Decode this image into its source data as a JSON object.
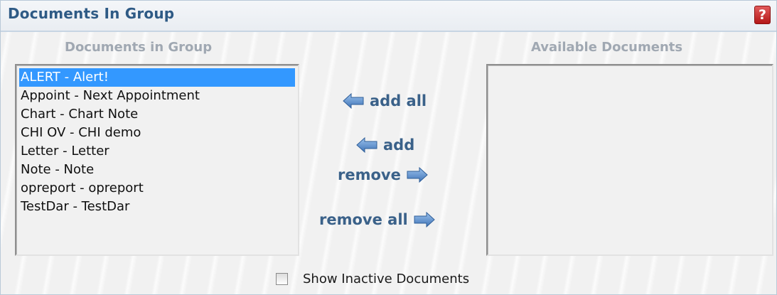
{
  "header": {
    "title": "Documents In Group",
    "help_glyph": "?"
  },
  "left_column": {
    "heading": "Documents in Group",
    "items": [
      {
        "label": "ALERT - Alert!",
        "selected": true
      },
      {
        "label": "Appoint - Next Appointment",
        "selected": false
      },
      {
        "label": "Chart - Chart Note",
        "selected": false
      },
      {
        "label": "CHI OV - CHI demo",
        "selected": false
      },
      {
        "label": "Letter - Letter",
        "selected": false
      },
      {
        "label": "Note - Note",
        "selected": false
      },
      {
        "label": "opreport - opreport",
        "selected": false
      },
      {
        "label": "TestDar - TestDar",
        "selected": false
      }
    ]
  },
  "right_column": {
    "heading": "Available Documents",
    "items": []
  },
  "actions": {
    "add_all": "add all",
    "add": "add",
    "remove": "remove",
    "remove_all": "remove all"
  },
  "footer": {
    "show_inactive_label": "Show Inactive Documents",
    "show_inactive_checked": false
  },
  "icons": {
    "help": "help-icon",
    "left_arrow": "arrow-left-icon",
    "right_arrow": "arrow-right-icon"
  },
  "colors": {
    "title": "#2e5a85",
    "column_heading": "#a0a8b2",
    "selected_row": "#3398ff",
    "action_text": "#3a6189",
    "arrow_fill": "#4f86c6",
    "help_button": "#c82222"
  }
}
